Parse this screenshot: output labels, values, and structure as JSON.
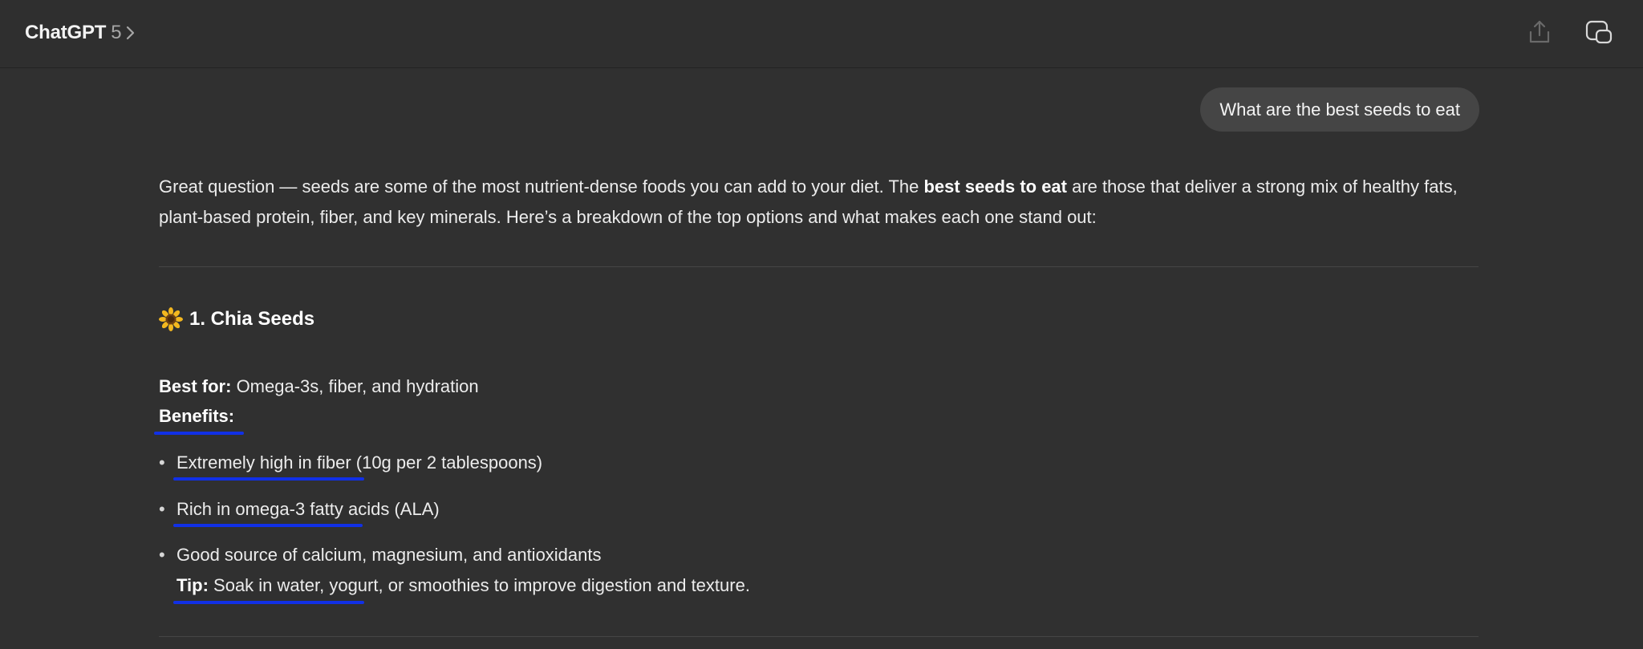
{
  "header": {
    "app_name": "ChatGPT",
    "model_version": "5",
    "icons": [
      "chevron-right-icon",
      "share-icon",
      "new-chat-icon"
    ]
  },
  "user_message": "What are the best seeds to eat",
  "answer": {
    "intro_before": "Great question — seeds are some of the most nutrient-dense foods you can add to your diet. The ",
    "intro_bold": "best seeds to eat",
    "intro_after": " are those that deliver a strong mix of healthy fats, plant-based protein, fiber, and key minerals. Here’s a breakdown of the top options and what makes each one stand out:",
    "section1": {
      "emoji_icon": "sunflower-icon",
      "title": "1. Chia Seeds",
      "best_for_label": "Best for:",
      "best_for_value": " Omega-3s, fiber, and hydration",
      "benefits_label": "Benefits:",
      "bullets": [
        "Extremely high in fiber (10g per 2 tablespoons)",
        "Rich in omega-3 fatty acids (ALA)",
        "Good source of calcium, magnesium, and antioxidants"
      ],
      "tip_label": "Tip:",
      "tip_text": " Soak in water, yogurt, or smoothies to improve digestion and texture."
    }
  },
  "colors": {
    "background": "#303030",
    "user_bubble": "#454545",
    "annotation_underline": "#1130e6"
  }
}
